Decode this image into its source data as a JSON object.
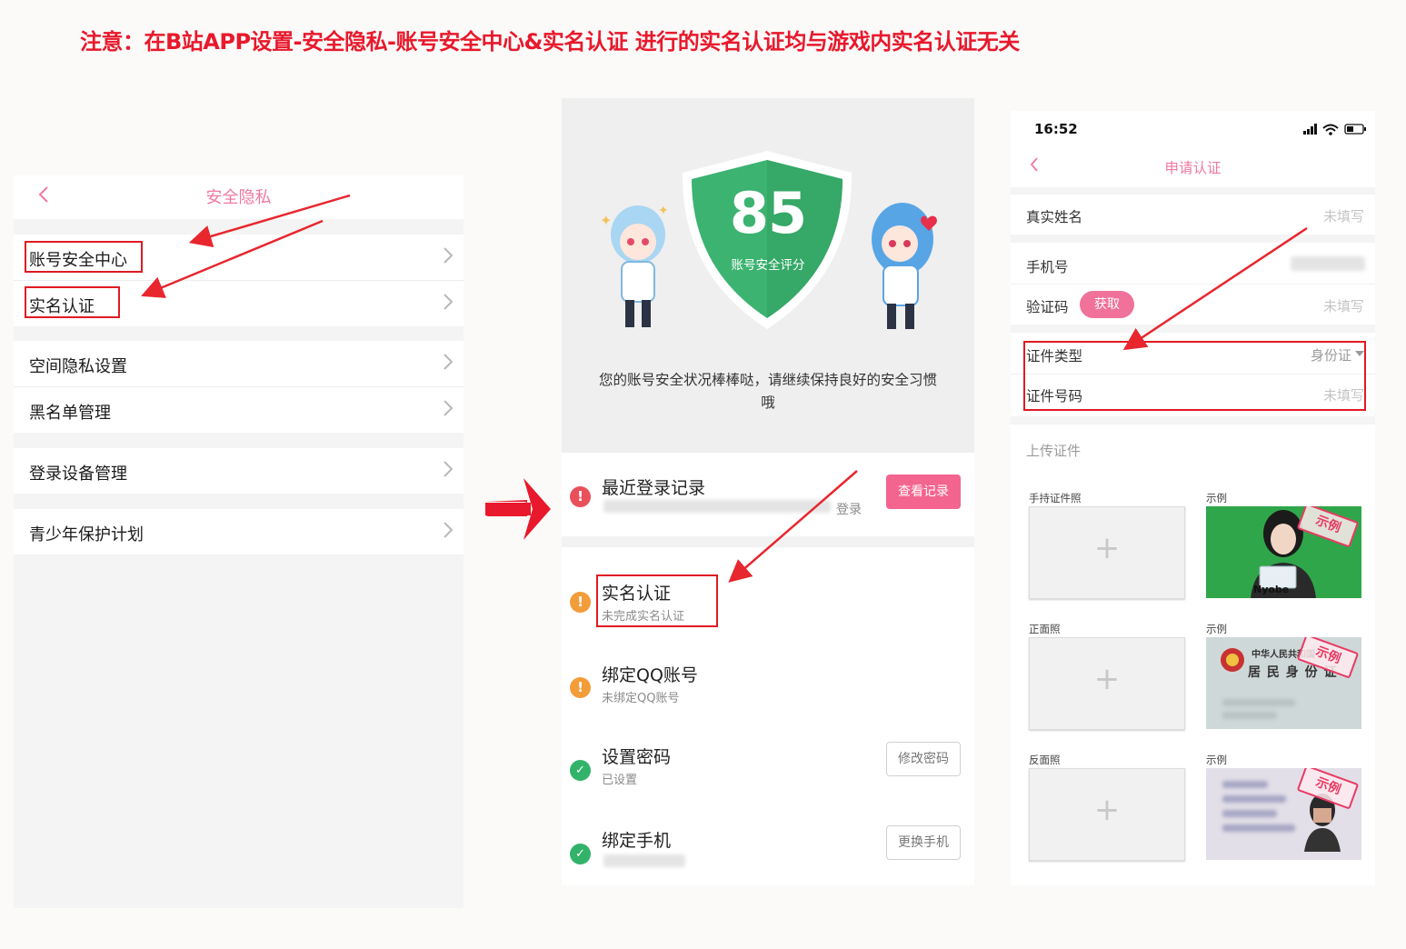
{
  "notice": "注意：在B站APP设置-安全隐私-账号安全中心&实名认证 进行的实名认证均与游戏内实名认证无关",
  "panel1": {
    "title": "安全隐私",
    "groups": [
      [
        "账号安全中心",
        "实名认证"
      ],
      [
        "空间隐私设置",
        "黑名单管理"
      ],
      [
        "登录设备管理"
      ],
      [
        "青少年保护计划"
      ]
    ]
  },
  "panel2": {
    "score": "85",
    "score_label": "账号安全评分",
    "desc": "您的账号安全状况棒棒哒，请继续保持良好的安全习惯哦",
    "login": {
      "title": "最近登录记录",
      "suffix": "登录",
      "button": "查看记录"
    },
    "items": [
      {
        "title": "实名认证",
        "sub": "未完成实名认证",
        "status": "warning"
      },
      {
        "title": "绑定QQ账号",
        "sub": "未绑定QQ账号",
        "status": "warning"
      },
      {
        "title": "设置密码",
        "sub": "已设置",
        "status": "ok",
        "button": "修改密码"
      },
      {
        "title": "绑定手机",
        "sub": "",
        "status": "ok",
        "button": "更换手机"
      }
    ],
    "colors": {
      "warning": "#f39c3a",
      "error": "#e9505a",
      "ok": "#33b36a",
      "shield": "#3cb371"
    }
  },
  "panel3": {
    "time": "16:52",
    "title": "申请认证",
    "fields": {
      "name_label": "真实姓名",
      "name_placeholder": "未填写",
      "phone_label": "手机号",
      "code_label": "验证码",
      "code_button": "获取",
      "code_placeholder": "未填写",
      "idtype_label": "证件类型",
      "idtype_value": "身份证",
      "idnum_label": "证件号码",
      "idnum_placeholder": "未填写"
    },
    "upload_title": "上传证件",
    "uploads": [
      {
        "label": "手持证件照",
        "sample_label": "示例"
      },
      {
        "label": "正面照",
        "sample_label": "示例"
      },
      {
        "label": "反面照",
        "sample_label": "示例"
      }
    ],
    "stamp_text": "示例",
    "plus": "+",
    "id_front_text": "中华人民共和国",
    "id_front_text2": "居 民 身 份 证",
    "hand_text": "Nyobe"
  }
}
